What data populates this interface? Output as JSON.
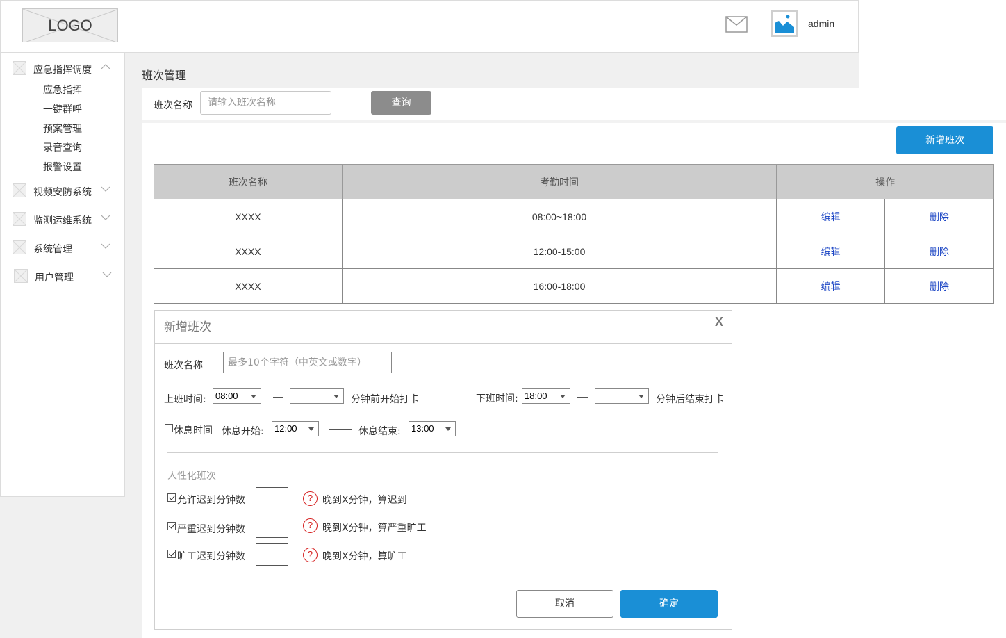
{
  "header": {
    "logo_text": "LOGO",
    "username": "admin"
  },
  "sidebar": {
    "groups": [
      {
        "label": "应急指挥调度",
        "expanded": true,
        "items": [
          "应急指挥",
          "一键群呼",
          "预案管理",
          "录音查询",
          "报警设置"
        ]
      },
      {
        "label": "视频安防系统",
        "expanded": false
      },
      {
        "label": "监测运维系统",
        "expanded": false
      },
      {
        "label": "系统管理",
        "expanded": false
      },
      {
        "label": "用户管理",
        "expanded": false
      }
    ]
  },
  "page": {
    "title": "班次管理"
  },
  "search": {
    "label": "班次名称",
    "placeholder": "请输入班次名称",
    "button": "查询"
  },
  "toolbar": {
    "add_button": "新增班次"
  },
  "table": {
    "headers": [
      "班次名称",
      "考勤时间",
      "操作"
    ],
    "rows": [
      {
        "name": "XXXX",
        "time": "08:00~18:00",
        "edit": "编辑",
        "delete": "删除"
      },
      {
        "name": "XXXX",
        "time": "12:00-15:00",
        "edit": "编辑",
        "delete": "删除"
      },
      {
        "name": "XXXX",
        "time": "16:00-18:00",
        "edit": "编辑",
        "delete": "删除"
      }
    ]
  },
  "dialog": {
    "title": "新增班次",
    "close": "X",
    "name_label": "班次名称",
    "name_placeholder": "最多10个字符（中英文或数字）",
    "start_label": "上班时间:",
    "start_value": "08:00",
    "start_minutes_value": "",
    "start_suffix": "分钟前开始打卡",
    "end_label": "下班时间:",
    "end_value": "18:00",
    "end_minutes_value": "",
    "end_suffix": "分钟后结束打卡",
    "rest_checkbox_label": "休息时间",
    "rest_checked": false,
    "rest_start_label": "休息开始:",
    "rest_start_value": "12:00",
    "rest_end_label": "休息结束:",
    "rest_end_value": "13:00",
    "section_title": "人性化班次",
    "rules": [
      {
        "label": "允许迟到分钟数",
        "checked": true,
        "hint": "晚到X分钟，算迟到"
      },
      {
        "label": "严重迟到分钟数",
        "checked": true,
        "hint": "晚到X分钟，算严重旷工"
      },
      {
        "label": "旷工迟到分钟数",
        "checked": true,
        "hint": "晚到X分钟，算旷工"
      }
    ],
    "help_icon_text": "?",
    "cancel": "取消",
    "confirm": "确定"
  },
  "colors": {
    "primary": "#1a8fd6",
    "query_button": "#8c8c8c",
    "link": "#1a44c4",
    "help_icon": "#d62020",
    "table_header": "#cccccc"
  }
}
